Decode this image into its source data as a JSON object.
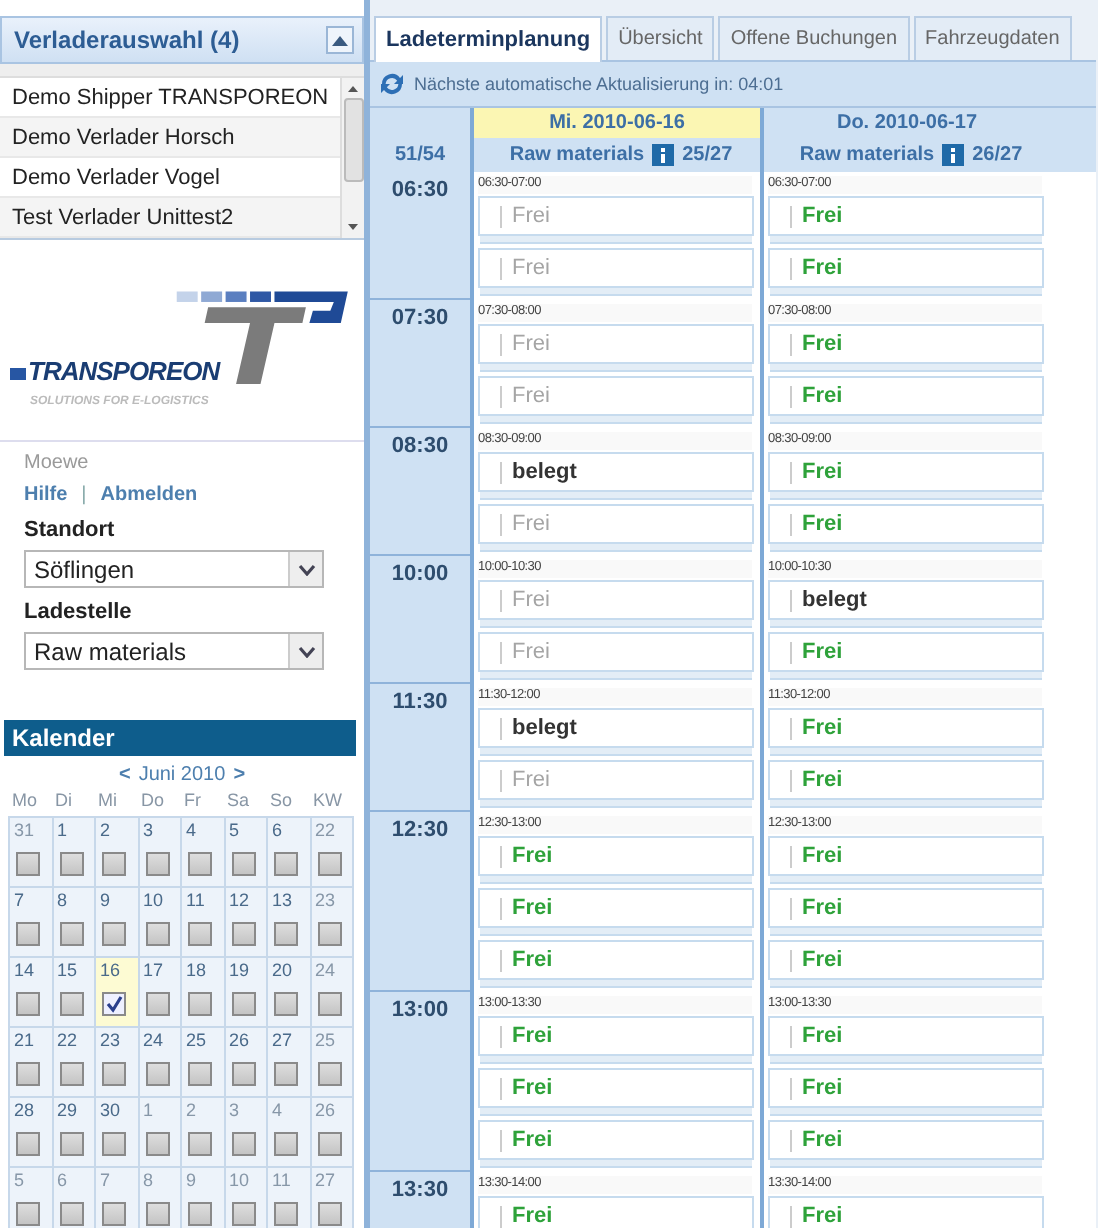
{
  "shipper_panel": {
    "title": "Verladerauswahl (4)",
    "items": [
      {
        "label": "Demo Shipper TRANSPOREON"
      },
      {
        "label": "Demo Verlader Horsch"
      },
      {
        "label": "Demo Verlader Vogel"
      },
      {
        "label": "Test Verlader Unittest2"
      }
    ]
  },
  "logo": {
    "name": "TRANSPOREON",
    "tagline": "SOLUTIONS FOR E-LOGISTICS"
  },
  "user": {
    "name": "Moewe",
    "links": [
      "Hilfe",
      "Abmelden"
    ],
    "separator": "|"
  },
  "filters": [
    {
      "label": "Standort",
      "value": "Söflingen"
    },
    {
      "label": "Ladestelle",
      "value": "Raw materials"
    }
  ],
  "calendar": {
    "title": "Kalender",
    "prev": "<",
    "month": "Juni 2010",
    "next": ">",
    "headings": [
      "Mo",
      "Di",
      "Mi",
      "Do",
      "Fr",
      "Sa",
      "So",
      "KW"
    ],
    "weeks": [
      {
        "days": [
          {
            "day": "31",
            "other_month": true,
            "checked": false
          },
          {
            "day": "1",
            "other_month": false,
            "checked": false
          },
          {
            "day": "2",
            "other_month": false,
            "checked": false
          },
          {
            "day": "3",
            "other_month": false,
            "checked": false
          },
          {
            "day": "4",
            "other_month": false,
            "checked": false
          },
          {
            "day": "5",
            "other_month": false,
            "checked": false
          },
          {
            "day": "6",
            "other_month": false,
            "checked": false
          }
        ],
        "kw": {
          "label": "22",
          "checked": false
        }
      },
      {
        "days": [
          {
            "day": "7",
            "other_month": false,
            "checked": false
          },
          {
            "day": "8",
            "other_month": false,
            "checked": false
          },
          {
            "day": "9",
            "other_month": false,
            "checked": false
          },
          {
            "day": "10",
            "other_month": false,
            "checked": false
          },
          {
            "day": "11",
            "other_month": false,
            "checked": false
          },
          {
            "day": "12",
            "other_month": false,
            "checked": false
          },
          {
            "day": "13",
            "other_month": false,
            "checked": false
          }
        ],
        "kw": {
          "label": "23",
          "checked": false
        }
      },
      {
        "days": [
          {
            "day": "14",
            "other_month": false,
            "checked": false
          },
          {
            "day": "15",
            "other_month": false,
            "checked": false
          },
          {
            "day": "16",
            "other_month": false,
            "checked": true
          },
          {
            "day": "17",
            "other_month": false,
            "checked": false
          },
          {
            "day": "18",
            "other_month": false,
            "checked": false
          },
          {
            "day": "19",
            "other_month": false,
            "checked": false
          },
          {
            "day": "20",
            "other_month": false,
            "checked": false
          }
        ],
        "kw": {
          "label": "24",
          "checked": false
        }
      },
      {
        "days": [
          {
            "day": "21",
            "other_month": false,
            "checked": false
          },
          {
            "day": "22",
            "other_month": false,
            "checked": false
          },
          {
            "day": "23",
            "other_month": false,
            "checked": false
          },
          {
            "day": "24",
            "other_month": false,
            "checked": false
          },
          {
            "day": "25",
            "other_month": false,
            "checked": false
          },
          {
            "day": "26",
            "other_month": false,
            "checked": false
          },
          {
            "day": "27",
            "other_month": false,
            "checked": false
          }
        ],
        "kw": {
          "label": "25",
          "checked": false
        }
      },
      {
        "days": [
          {
            "day": "28",
            "other_month": false,
            "checked": false
          },
          {
            "day": "29",
            "other_month": false,
            "checked": false
          },
          {
            "day": "30",
            "other_month": false,
            "checked": false
          },
          {
            "day": "1",
            "other_month": true,
            "checked": false
          },
          {
            "day": "2",
            "other_month": true,
            "checked": false
          },
          {
            "day": "3",
            "other_month": true,
            "checked": false
          },
          {
            "day": "4",
            "other_month": true,
            "checked": false
          }
        ],
        "kw": {
          "label": "26",
          "checked": false
        }
      },
      {
        "days": [
          {
            "day": "5",
            "other_month": true,
            "checked": false
          },
          {
            "day": "6",
            "other_month": true,
            "checked": false
          },
          {
            "day": "7",
            "other_month": true,
            "checked": false
          },
          {
            "day": "8",
            "other_month": true,
            "checked": false
          },
          {
            "day": "9",
            "other_month": true,
            "checked": false
          },
          {
            "day": "10",
            "other_month": true,
            "checked": false
          },
          {
            "day": "11",
            "other_month": true,
            "checked": false
          }
        ],
        "kw": {
          "label": "27",
          "checked": false
        }
      }
    ]
  },
  "tabs": [
    {
      "label": "Ladeterminplanung",
      "selected": true
    },
    {
      "label": "Übersicht",
      "selected": false
    },
    {
      "label": "Offene Buchungen",
      "selected": false
    },
    {
      "label": "Fahrzeugdaten",
      "selected": false
    }
  ],
  "refresh_bar": {
    "text": "Nächste automatische Aktualisierung in: 04:01"
  },
  "schedule": {
    "total": "51/54",
    "days": [
      {
        "date": "Mi. 2010-06-16",
        "selected": true,
        "location": "Raw materials",
        "capacity": "25/27"
      },
      {
        "date": "Do. 2010-06-17",
        "selected": false,
        "location": "Raw materials",
        "capacity": "26/27"
      }
    ],
    "rows": [
      {
        "time": "06:30",
        "cells": [
          {
            "range": "06:30-07:00",
            "slots": [
              {
                "label": "Frei",
                "kind": "closed"
              },
              {
                "label": "Frei",
                "kind": "closed"
              }
            ]
          },
          {
            "range": "06:30-07:00",
            "slots": [
              {
                "label": "Frei",
                "kind": "free"
              },
              {
                "label": "Frei",
                "kind": "free"
              }
            ]
          }
        ]
      },
      {
        "time": "07:30",
        "cells": [
          {
            "range": "07:30-08:00",
            "slots": [
              {
                "label": "Frei",
                "kind": "closed"
              },
              {
                "label": "Frei",
                "kind": "closed"
              }
            ]
          },
          {
            "range": "07:30-08:00",
            "slots": [
              {
                "label": "Frei",
                "kind": "free"
              },
              {
                "label": "Frei",
                "kind": "free"
              }
            ]
          }
        ]
      },
      {
        "time": "08:30",
        "cells": [
          {
            "range": "08:30-09:00",
            "slots": [
              {
                "label": "belegt",
                "kind": "booked"
              },
              {
                "label": "Frei",
                "kind": "closed"
              }
            ]
          },
          {
            "range": "08:30-09:00",
            "slots": [
              {
                "label": "Frei",
                "kind": "free"
              },
              {
                "label": "Frei",
                "kind": "free"
              }
            ]
          }
        ]
      },
      {
        "time": "10:00",
        "cells": [
          {
            "range": "10:00-10:30",
            "slots": [
              {
                "label": "Frei",
                "kind": "closed"
              },
              {
                "label": "Frei",
                "kind": "closed"
              }
            ]
          },
          {
            "range": "10:00-10:30",
            "slots": [
              {
                "label": "belegt",
                "kind": "booked"
              },
              {
                "label": "Frei",
                "kind": "free"
              }
            ]
          }
        ]
      },
      {
        "time": "11:30",
        "cells": [
          {
            "range": "11:30-12:00",
            "slots": [
              {
                "label": "belegt",
                "kind": "booked"
              },
              {
                "label": "Frei",
                "kind": "closed"
              }
            ]
          },
          {
            "range": "11:30-12:00",
            "slots": [
              {
                "label": "Frei",
                "kind": "free"
              },
              {
                "label": "Frei",
                "kind": "free"
              }
            ]
          }
        ]
      },
      {
        "time": "12:30",
        "cells": [
          {
            "range": "12:30-13:00",
            "slots": [
              {
                "label": "Frei",
                "kind": "free"
              },
              {
                "label": "Frei",
                "kind": "free"
              },
              {
                "label": "Frei",
                "kind": "free"
              }
            ]
          },
          {
            "range": "12:30-13:00",
            "slots": [
              {
                "label": "Frei",
                "kind": "free"
              },
              {
                "label": "Frei",
                "kind": "free"
              },
              {
                "label": "Frei",
                "kind": "free"
              }
            ]
          }
        ]
      },
      {
        "time": "13:00",
        "cells": [
          {
            "range": "13:00-13:30",
            "slots": [
              {
                "label": "Frei",
                "kind": "free"
              },
              {
                "label": "Frei",
                "kind": "free"
              },
              {
                "label": "Frei",
                "kind": "free"
              }
            ]
          },
          {
            "range": "13:00-13:30",
            "slots": [
              {
                "label": "Frei",
                "kind": "free"
              },
              {
                "label": "Frei",
                "kind": "free"
              },
              {
                "label": "Frei",
                "kind": "free"
              }
            ]
          }
        ]
      },
      {
        "time": "13:30",
        "cells": [
          {
            "range": "13:30-14:00",
            "slots": [
              {
                "label": "Frei",
                "kind": "free"
              }
            ]
          },
          {
            "range": "13:30-14:00",
            "slots": [
              {
                "label": "Frei",
                "kind": "free"
              }
            ]
          }
        ]
      }
    ]
  }
}
